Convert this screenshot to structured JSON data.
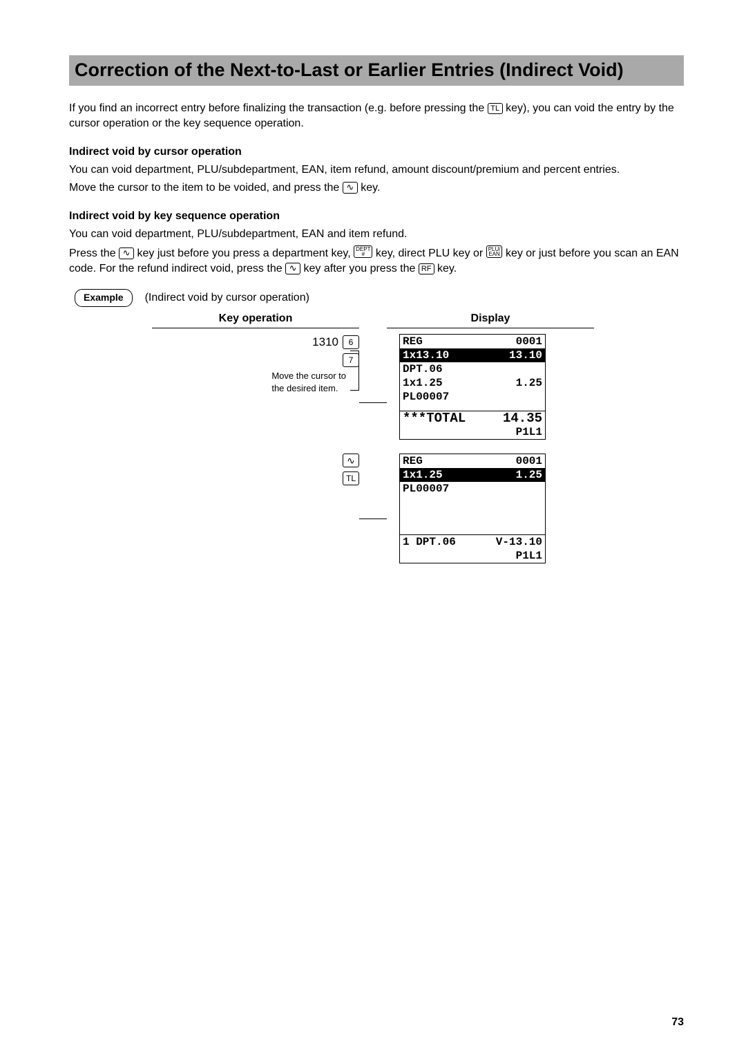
{
  "title": "Correction of the Next-to-Last or Earlier Entries (Indirect Void)",
  "intro": {
    "p1a": "If you find an incorrect entry before finalizing the transaction (e.g. before pressing the ",
    "p1b": " key), you can void the entry by the cursor operation or the key sequence operation.",
    "tl_key": "TL"
  },
  "cursor_section": {
    "heading": "Indirect void by cursor operation",
    "line1": "You can void department, PLU/subdepartment, EAN, item refund, amount discount/premium and percent entries.",
    "line2a": "Move the cursor to the item to be voided, and press the ",
    "line2b": " key."
  },
  "keyseq_section": {
    "heading": "Indirect void by key sequence operation",
    "line1": "You can void department, PLU/subdepartment, EAN and item refund.",
    "line2a": "Press the ",
    "line2b": " key just before you press a department key, ",
    "line2c": " key, direct PLU key or ",
    "line2d": " key or just before you scan an EAN code.  For the refund indirect void, press the ",
    "line2e": " key after you press the ",
    "line2f": " key.",
    "dept_key": "DEPT\n#",
    "plu_key": "PLU/\nEAN",
    "rf_key": "RF"
  },
  "example_label": "Example",
  "example_caption": "(Indirect void by cursor operation)",
  "columns": {
    "key_op": "Key operation",
    "display": "Display"
  },
  "keyop": {
    "num1": "1310",
    "k6": "6",
    "k7": "7",
    "cursor_note_l1": "Move the cursor to",
    "cursor_note_l2": "the desired item.",
    "tl": "TL"
  },
  "screen1": {
    "r1l": "REG",
    "r1r": "0001",
    "r2l": "1x13.10",
    "r2r": "13.10",
    "r3l": "DPT.06",
    "r3r": "",
    "r4l": "1x1.25",
    "r4r": "1.25",
    "r5l": "PL00007",
    "r5r": "",
    "r6l": "***TOTAL",
    "r6r": "14.35",
    "r7l": "",
    "r7r": "P1L1"
  },
  "screen2": {
    "r1l": "REG",
    "r1r": "0001",
    "r2l": "1x1.25",
    "r2r": "1.25",
    "r3l": "PL00007",
    "r3r": "",
    "r4l": "1 DPT.06",
    "r4r": "V-13.10",
    "r5l": "",
    "r5r": "P1L1"
  },
  "page_number": "73"
}
